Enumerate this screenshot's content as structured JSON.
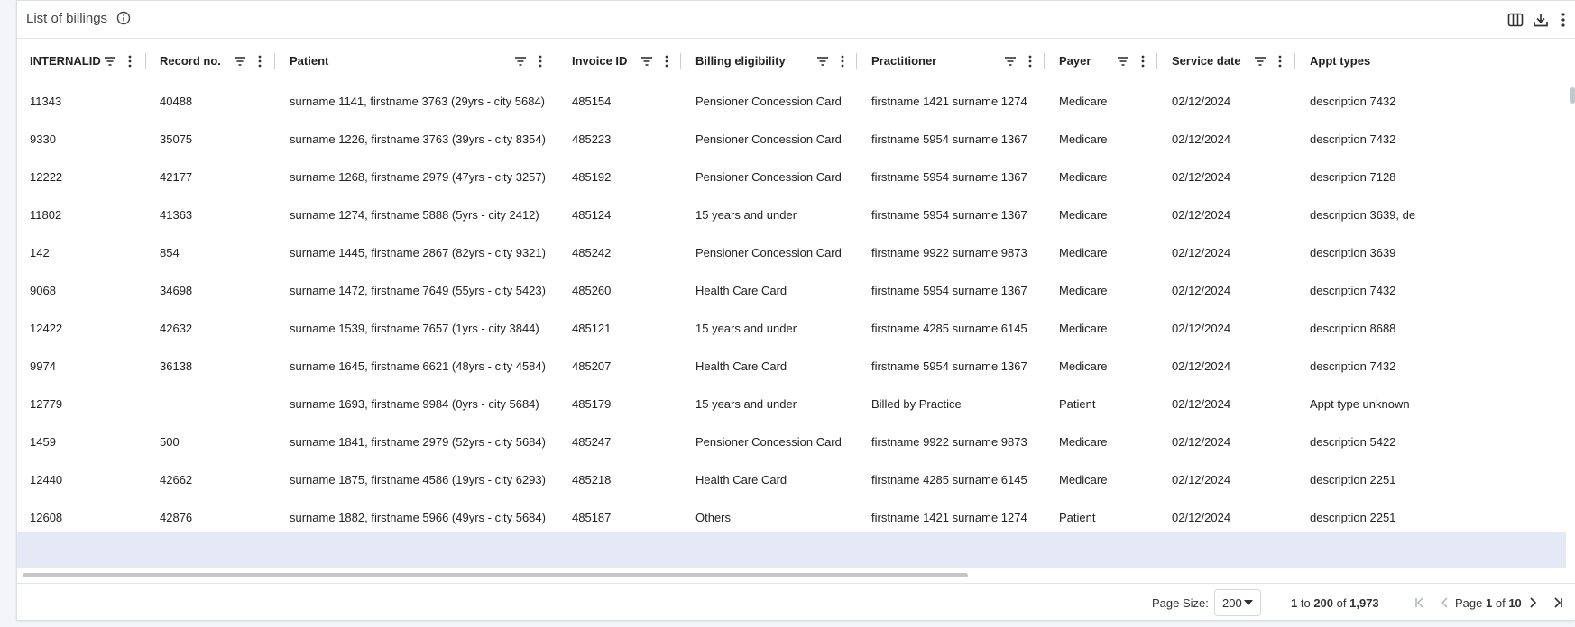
{
  "title": "List of billings",
  "toolbar": {
    "columns_icon": "columns-icon",
    "download_icon": "download-icon",
    "more_icon": "more-vertical-icon"
  },
  "columns": [
    {
      "key": "internalid",
      "label": "INTERNALID"
    },
    {
      "key": "record_no",
      "label": "Record no."
    },
    {
      "key": "patient",
      "label": "Patient"
    },
    {
      "key": "invoice_id",
      "label": "Invoice ID"
    },
    {
      "key": "billing_eligibility",
      "label": "Billing eligibility"
    },
    {
      "key": "practitioner",
      "label": "Practitioner"
    },
    {
      "key": "payer",
      "label": "Payer"
    },
    {
      "key": "service_date",
      "label": "Service date"
    },
    {
      "key": "appt_types",
      "label": "Appt types"
    }
  ],
  "rows": [
    [
      "11343",
      "40488",
      "surname 1141, firstname 3763 (29yrs - city 5684)",
      "485154",
      "Pensioner Concession Card",
      "firstname 1421 surname 1274",
      "Medicare",
      "02/12/2024",
      "description 7432"
    ],
    [
      "9330",
      "35075",
      "surname 1226, firstname 3763 (39yrs - city 8354)",
      "485223",
      "Pensioner Concession Card",
      "firstname 5954 surname 1367",
      "Medicare",
      "02/12/2024",
      "description 7432"
    ],
    [
      "12222",
      "42177",
      "surname 1268, firstname 2979 (47yrs - city 3257)",
      "485192",
      "Pensioner Concession Card",
      "firstname 5954 surname 1367",
      "Medicare",
      "02/12/2024",
      "description 7128"
    ],
    [
      "11802",
      "41363",
      "surname 1274, firstname 5888 (5yrs - city 2412)",
      "485124",
      "15 years and under",
      "firstname 5954 surname 1367",
      "Medicare",
      "02/12/2024",
      "description 3639, de"
    ],
    [
      "142",
      "854",
      "surname 1445, firstname 2867 (82yrs - city 9321)",
      "485242",
      "Pensioner Concession Card",
      "firstname 9922 surname 9873",
      "Medicare",
      "02/12/2024",
      "description 3639"
    ],
    [
      "9068",
      "34698",
      "surname 1472, firstname 7649 (55yrs - city 5423)",
      "485260",
      "Health Care Card",
      "firstname 5954 surname 1367",
      "Medicare",
      "02/12/2024",
      "description 7432"
    ],
    [
      "12422",
      "42632",
      "surname 1539, firstname 7657 (1yrs - city 3844)",
      "485121",
      "15 years and under",
      "firstname 4285 surname 6145",
      "Medicare",
      "02/12/2024",
      "description 8688"
    ],
    [
      "9974",
      "36138",
      "surname 1645, firstname 6621 (48yrs - city 4584)",
      "485207",
      "Health Care Card",
      "firstname 5954 surname 1367",
      "Medicare",
      "02/12/2024",
      "description 7432"
    ],
    [
      "12779",
      "",
      "surname 1693, firstname 9984 (0yrs - city 5684)",
      "485179",
      "15 years and under",
      "Billed by Practice",
      "Patient",
      "02/12/2024",
      "Appt type unknown"
    ],
    [
      "1459",
      "500",
      "surname 1841, firstname 2979 (52yrs - city 5684)",
      "485247",
      "Pensioner Concession Card",
      "firstname 9922 surname 9873",
      "Medicare",
      "02/12/2024",
      "description 5422"
    ],
    [
      "12440",
      "42662",
      "surname 1875, firstname 4586 (19yrs - city 6293)",
      "485218",
      "Health Care Card",
      "firstname 4285 surname 6145",
      "Medicare",
      "02/12/2024",
      "description 2251"
    ],
    [
      "12608",
      "42876",
      "surname 1882, firstname 5966 (49yrs - city 5684)",
      "485187",
      "Others",
      "firstname 1421 surname 1274",
      "Patient",
      "02/12/2024",
      "description 2251"
    ]
  ],
  "footer": {
    "page_size_label": "Page Size:",
    "page_size_value": "200",
    "range_from": "1",
    "range_to_word": "to",
    "range_to": "200",
    "range_of_word": "of",
    "total": "1,973",
    "page_word": "Page",
    "page_current": "1",
    "page_of_word": "of",
    "page_total": "10"
  },
  "colors": {
    "accent_filler": "#e4e9f5",
    "border": "#e3e5ea",
    "header_text": "#222222"
  }
}
